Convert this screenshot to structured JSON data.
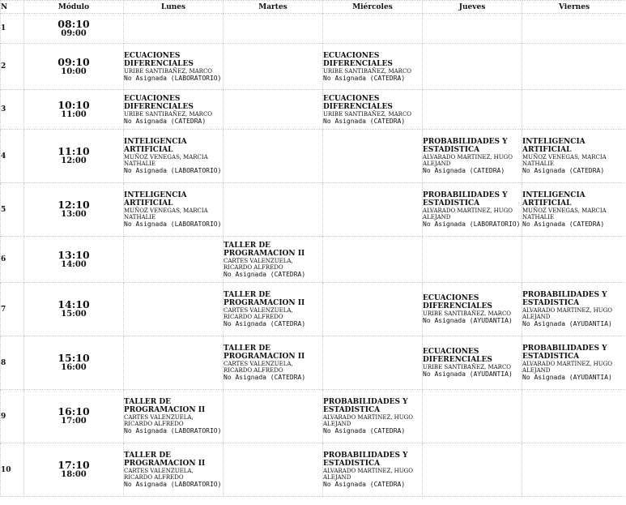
{
  "headers": [
    "N",
    "Módulo",
    "Lunes",
    "Martes",
    "Miércoles",
    "Jueves",
    "Viernes"
  ],
  "rows": [
    {
      "n": "1",
      "start": "08:10",
      "end": "09:00",
      "cells": [
        null,
        null,
        null,
        null,
        null
      ]
    },
    {
      "n": "2",
      "start": "09:10",
      "end": "10:00",
      "cells": [
        {
          "course": "ECUACIONES DIFERENCIALES",
          "prof": "URIBE SANTIBAÑEZ, MARCO",
          "room": "No Asignada (LABORATORIO)"
        },
        null,
        {
          "course": "ECUACIONES DIFERENCIALES",
          "prof": "URIBE SANTIBAÑEZ, MARCO",
          "room": "No Asignada (CATEDRA)"
        },
        null,
        null
      ]
    },
    {
      "n": "3",
      "start": "10:10",
      "end": "11:00",
      "cells": [
        {
          "course": "ECUACIONES DIFERENCIALES",
          "prof": "URIBE SANTIBAÑEZ, MARCO",
          "room": "No Asignada (CATEDRA)"
        },
        null,
        {
          "course": "ECUACIONES DIFERENCIALES",
          "prof": "URIBE SANTIBAÑEZ, MARCO",
          "room": "No Asignada (CATEDRA)"
        },
        null,
        null
      ]
    },
    {
      "n": "4",
      "start": "11:10",
      "end": "12:00",
      "cells": [
        {
          "course": "INTELIGENCIA ARTIFICIAL",
          "prof": "MUÑOZ VENEGAS, MARCIA NATHALIE",
          "room": "No Asignada (LABORATORIO)"
        },
        null,
        null,
        {
          "course": "PROBABILIDADES Y ESTADISTICA",
          "prof": "ALVARADO MARTINEZ, HUGO ALEJAND",
          "room": "No Asignada (CATEDRA)"
        },
        {
          "course": "INTELIGENCIA ARTIFICIAL",
          "prof": "MUÑOZ VENEGAS, MARCIA NATHALIE",
          "room": "No Asignada (CATEDRA)"
        }
      ]
    },
    {
      "n": "5",
      "start": "12:10",
      "end": "13:00",
      "cells": [
        {
          "course": "INTELIGENCIA ARTIFICIAL",
          "prof": "MUÑOZ VENEGAS, MARCIA NATHALIE",
          "room": "No Asignada (LABORATORIO)"
        },
        null,
        null,
        {
          "course": "PROBABILIDADES Y ESTADISTICA",
          "prof": "ALVARADO MARTINEZ, HUGO ALEJAND",
          "room": "No Asignada (LABORATORIO)"
        },
        {
          "course": "INTELIGENCIA ARTIFICIAL",
          "prof": "MUÑOZ VENEGAS, MARCIA NATHALIE",
          "room": "No Asignada (CATEDRA)"
        }
      ]
    },
    {
      "n": "6",
      "start": "13:10",
      "end": "14:00",
      "cells": [
        null,
        {
          "course": "TALLER DE PROGRAMACION II",
          "prof": "CARTES VALENZUELA, RICARDO ALFREDO",
          "room": "No Asignada (CATEDRA)"
        },
        null,
        null,
        null
      ]
    },
    {
      "n": "7",
      "start": "14:10",
      "end": "15:00",
      "cells": [
        null,
        {
          "course": "TALLER DE PROGRAMACION II",
          "prof": "CARTES VALENZUELA, RICARDO ALFREDO",
          "room": "No Asignada (CATEDRA)"
        },
        null,
        {
          "course": "ECUACIONES DIFERENCIALES",
          "prof": "URIBE SANTIBAÑEZ, MARCO",
          "room": "No Asignada (AYUDANTIA)"
        },
        {
          "course": "PROBABILIDADES Y ESTADISTICA",
          "prof": "ALVARADO MARTINEZ, HUGO ALEJAND",
          "room": "No Asignada (AYUDANTIA)"
        }
      ]
    },
    {
      "n": "8",
      "start": "15:10",
      "end": "16:00",
      "cells": [
        null,
        {
          "course": "TALLER DE PROGRAMACION II",
          "prof": "CARTES VALENZUELA, RICARDO ALFREDO",
          "room": "No Asignada (CATEDRA)"
        },
        null,
        {
          "course": "ECUACIONES DIFERENCIALES",
          "prof": "URIBE SANTIBAÑEZ, MARCO",
          "room": "No Asignada (AYUDANTIA)"
        },
        {
          "course": "PROBABILIDADES Y ESTADISTICA",
          "prof": "ALVARADO MARTINEZ, HUGO ALEJAND",
          "room": "No Asignada (AYUDANTIA)"
        }
      ]
    },
    {
      "n": "9",
      "start": "16:10",
      "end": "17:00",
      "cells": [
        {
          "course": "TALLER DE PROGRAMACION II",
          "prof": "CARTES VALENZUELA, RICARDO ALFREDO",
          "room": "No Asignada (LABORATORIO)"
        },
        null,
        {
          "course": "PROBABILIDADES Y ESTADISTICA",
          "prof": "ALVARADO MARTINEZ, HUGO ALEJAND",
          "room": "No Asignada (CATEDRA)"
        },
        null,
        null
      ]
    },
    {
      "n": "10",
      "start": "17:10",
      "end": "18:00",
      "cells": [
        {
          "course": "TALLER DE PROGRAMACION II",
          "prof": "CARTES VALENZUELA, RICARDO ALFREDO",
          "room": "No Asignada (LABORATORIO)"
        },
        null,
        {
          "course": "PROBABILIDADES Y ESTADISTICA",
          "prof": "ALVARADO MARTINEZ, HUGO ALEJAND",
          "room": "No Asignada (CATEDRA)"
        },
        null,
        null
      ]
    }
  ]
}
